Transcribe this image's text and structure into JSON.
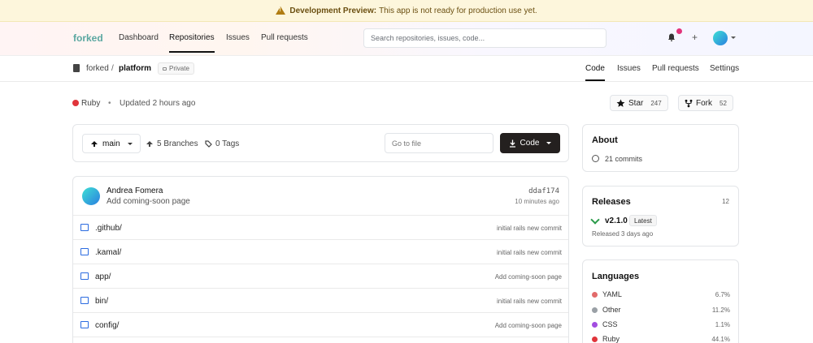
{
  "banner": {
    "title": "Development Preview:",
    "text": "This app is not ready for production use yet."
  },
  "topnav": {
    "logo": "forked",
    "links": [
      {
        "label": "Dashboard"
      },
      {
        "label": "Repositories"
      },
      {
        "label": "Issues"
      },
      {
        "label": "Pull requests"
      }
    ],
    "search_placeholder": "Search repositories, issues, code...",
    "plus": "+"
  },
  "repo": {
    "owner": "forked",
    "slash": "/",
    "name": "platform",
    "visibility": "Private",
    "tabs": [
      {
        "label": "Code"
      },
      {
        "label": "Issues"
      },
      {
        "label": "Pull requests"
      },
      {
        "label": "Settings"
      }
    ],
    "language": "Ruby",
    "language_color": "#e0353b",
    "separator": "•",
    "updated": "Updated 2 hours ago",
    "star": {
      "label": "Star",
      "count": "247"
    },
    "fork": {
      "label": "Fork",
      "count": "52"
    }
  },
  "toolbar": {
    "branch": "main",
    "branches": "5 Branches",
    "tags": "0 Tags",
    "goto_placeholder": "Go to file",
    "code_label": "Code"
  },
  "latest_commit": {
    "author": "Andrea Fomera",
    "message": "Add coming-soon page",
    "sha": "ddaf174",
    "time": "10 minutes ago"
  },
  "files": [
    {
      "name": ".github/",
      "commit": "initial rails new commit"
    },
    {
      "name": ".kamal/",
      "commit": "initial rails new commit"
    },
    {
      "name": "app/",
      "commit": "Add coming-soon page"
    },
    {
      "name": "bin/",
      "commit": "initial rails new commit"
    },
    {
      "name": "config/",
      "commit": "Add coming-soon page"
    }
  ],
  "about": {
    "title": "About",
    "commits": "21 commits"
  },
  "releases": {
    "title": "Releases",
    "count": "12",
    "version": "v2.1.0",
    "badge": "Latest",
    "released": "Released 3 days ago"
  },
  "languages": {
    "title": "Languages",
    "items": [
      {
        "name": "YAML",
        "pct": "6.7%",
        "color": "#e26b6b"
      },
      {
        "name": "Other",
        "pct": "11.2%",
        "color": "#9aa0a6"
      },
      {
        "name": "CSS",
        "pct": "1.1%",
        "color": "#a24de0"
      },
      {
        "name": "Ruby",
        "pct": "44.1%",
        "color": "#e0353b"
      }
    ]
  }
}
